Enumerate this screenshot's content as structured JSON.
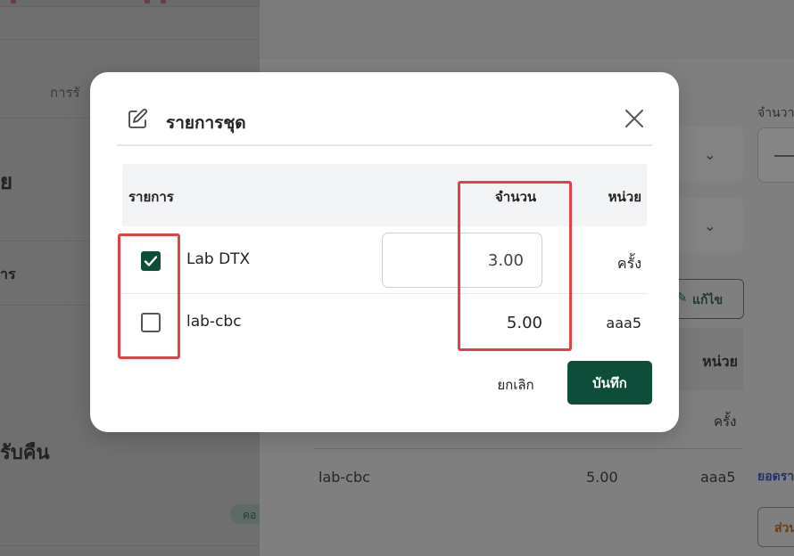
{
  "background": {
    "left": {
      "tab_label": "การรั",
      "heading1": "ย",
      "row_label": "าร",
      "heading2": "รับคืน",
      "pill": "คอ"
    },
    "right": {
      "qty_label": "จำนวา",
      "edit_button": "แก้ไข",
      "table_unit_header": "หน่วย",
      "row1_unit": "ครั้ง",
      "row2": {
        "name": "lab-cbc",
        "qty": "5.00",
        "unit": "aaa5"
      },
      "balance_link": "ยอดรา",
      "orange_button": "ส่วน"
    }
  },
  "modal": {
    "title": "รายการชุด",
    "columns": {
      "name": "รายการ",
      "quantity": "จำนวน",
      "unit": "หน่วย"
    },
    "rows": [
      {
        "name": "Lab DTX",
        "quantity": "3.00",
        "unit": "ครั้ง",
        "checked": true
      },
      {
        "name": "lab-cbc",
        "quantity": "5.00",
        "unit": "aaa5",
        "checked": false
      }
    ],
    "cancel_label": "ยกเลิก",
    "save_label": "บันทึก"
  },
  "colors": {
    "primary": "#0e4d3a",
    "highlight": "#e04343",
    "header_bg": "#f2f3f5"
  }
}
